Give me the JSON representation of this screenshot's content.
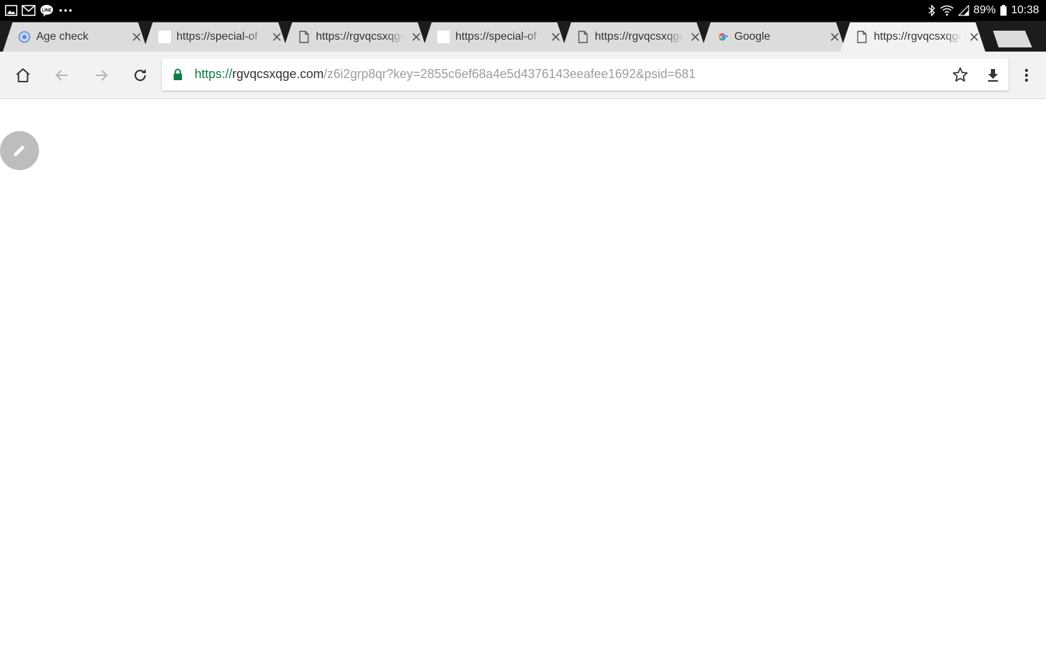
{
  "status_bar": {
    "notification_icons": [
      "gallery-icon",
      "email-icon",
      "line-chat-icon",
      "more-dots-icon"
    ],
    "battery_percent": "89%",
    "time": "10:38",
    "system_icons": [
      "bluetooth-icon",
      "wifi-icon",
      "signal-icon",
      "battery-icon"
    ]
  },
  "tabs": [
    {
      "title": "Age check",
      "favicon": "age-check-favicon",
      "active": false
    },
    {
      "title": "https://special-of",
      "favicon": "blank-page-favicon",
      "active": false
    },
    {
      "title": "https://rgvqcsxqge",
      "favicon": "document-favicon",
      "active": false
    },
    {
      "title": "https://special-of",
      "favicon": "blank-page-favicon",
      "active": false
    },
    {
      "title": "https://rgvqcsxqge",
      "favicon": "document-favicon",
      "active": false
    },
    {
      "title": "Google",
      "favicon": "google-favicon",
      "active": false
    },
    {
      "title": "https://rgvqcsxqge",
      "favicon": "document-favicon",
      "active": true
    }
  ],
  "toolbar": {
    "home_icon": "home-icon",
    "back_icon": "back-arrow-icon",
    "forward_icon": "forward-arrow-icon",
    "reload_icon": "reload-icon",
    "bookmark_icon": "star-icon",
    "download_icon": "download-icon",
    "menu_icon": "kebab-menu-icon"
  },
  "omnibox": {
    "secure": true,
    "scheme": "https://",
    "host": "rgvqcsxqge.com",
    "path": "/z6i2grp8qr?key=2855c6ef68a4e5d4376143eeafee1692&psid=681"
  },
  "page": {
    "fab_icon": "pencil-icon"
  },
  "colors": {
    "status_bar": "#000000",
    "tab_strip": "#1c1c1c",
    "inactive_tab": "#dcdcdc",
    "active_tab": "#f2f2f2",
    "url_scheme": "#0b8043",
    "url_host": "#333333",
    "url_path": "#9e9e9e",
    "fab": "#bdbdbd"
  }
}
